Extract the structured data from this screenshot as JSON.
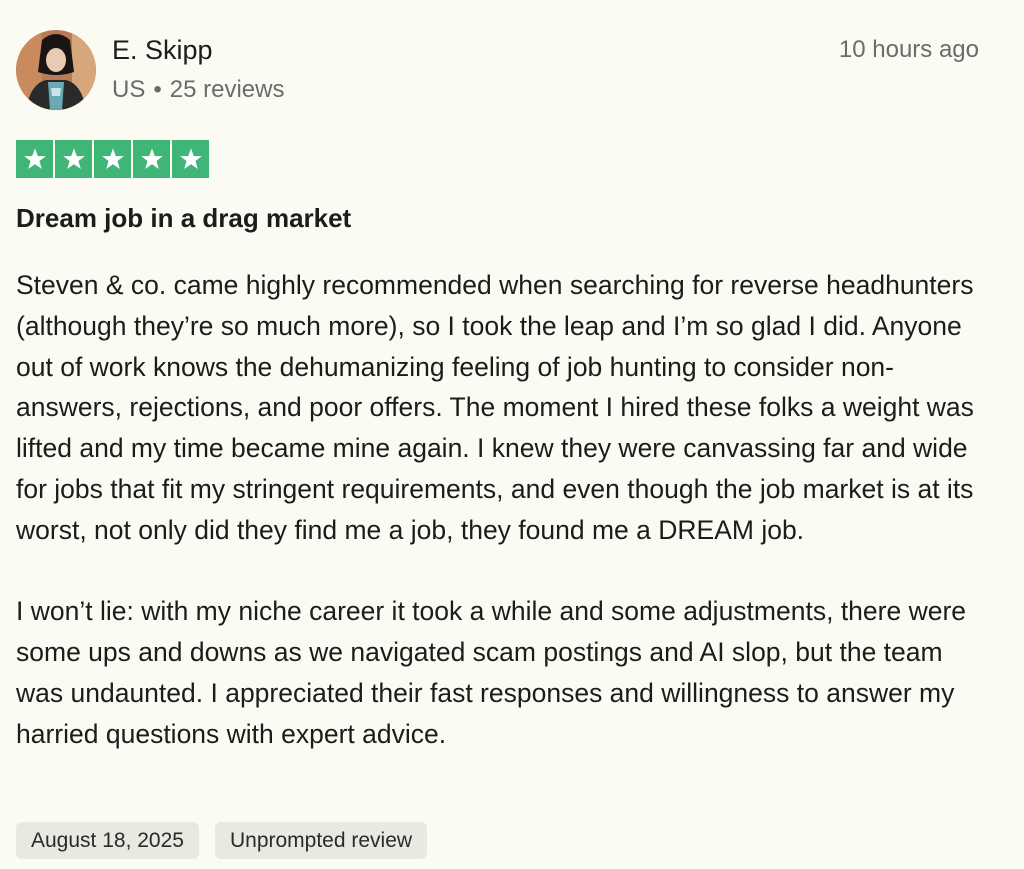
{
  "reviewer": {
    "name": "E. Skipp",
    "country": "US",
    "separator": "•",
    "review_count": "25 reviews"
  },
  "timestamp": "10 hours ago",
  "rating": {
    "stars": 5,
    "max": 5,
    "color": "#3fb578"
  },
  "review": {
    "title": "Dream job in a drag market",
    "paragraphs": [
      "Steven & co. came highly recommended when searching for reverse headhunters (although they’re so much more), so I took the leap and I’m so glad I did. Anyone out of work knows the dehumanizing feeling of job hunting to consider non-answers, rejections, and poor offers. The moment I hired these folks a weight was lifted and my time became mine again. I knew they were canvassing far and wide for jobs that fit my stringent requirements, and even though the job market is at its worst, not only did they find me a job, they found me a DREAM job.",
      "I won’t lie: with my niche career it took a while and some adjustments, there were some ups and downs as we navigated scam postings and AI slop, but the team was undaunted. I appreciated their fast responses and willingness to answer my harried questions with expert advice."
    ]
  },
  "tags": {
    "date": "August 18, 2025",
    "type": "Unprompted review"
  }
}
